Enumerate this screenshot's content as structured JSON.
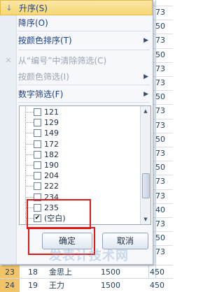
{
  "sheet": {
    "right_values": [
      "73",
      "50",
      "73",
      "50",
      "73",
      "73",
      "50",
      "73",
      "73",
      "50",
      "73",
      "50",
      "73",
      "73",
      "40",
      "73",
      "50",
      "73"
    ],
    "bottom_rows": [
      {
        "row": "23",
        "col_b": "18",
        "name": "金思上",
        "amount": "1500",
        "last": "450"
      },
      {
        "row": "24",
        "col_b": "19",
        "name": "王力",
        "amount": "1500",
        "last": "450"
      }
    ]
  },
  "menu": {
    "items": [
      {
        "label": "升序(S)",
        "icon": "sort-asc-icon",
        "glyph": "↓",
        "disabled": false,
        "hover": true,
        "arrow": false
      },
      {
        "label": "降序(O)",
        "icon": "sort-desc-icon",
        "glyph": "",
        "disabled": false,
        "hover": false,
        "arrow": false
      },
      {
        "label": "按颜色排序(T)",
        "icon": "",
        "glyph": "",
        "disabled": false,
        "hover": false,
        "arrow": true
      },
      {
        "label": "从“编号”中清除筛选(C)",
        "icon": "clear-filter-icon",
        "glyph": "✕",
        "disabled": true,
        "hover": false,
        "arrow": false
      },
      {
        "label": "按颜色筛选(I)",
        "icon": "",
        "glyph": "",
        "disabled": true,
        "hover": false,
        "arrow": true
      },
      {
        "label": "数字筛选(F)",
        "icon": "",
        "glyph": "",
        "disabled": false,
        "hover": false,
        "arrow": true
      }
    ],
    "list": [
      {
        "text": "121",
        "checked": false
      },
      {
        "text": "129",
        "checked": false
      },
      {
        "text": "149",
        "checked": false
      },
      {
        "text": "172",
        "checked": false
      },
      {
        "text": "182",
        "checked": false
      },
      {
        "text": "190",
        "checked": false
      },
      {
        "text": "204",
        "checked": false
      },
      {
        "text": "222",
        "checked": false
      },
      {
        "text": "234",
        "checked": false
      },
      {
        "text": "235",
        "checked": false
      },
      {
        "text": "(空白)",
        "checked": true
      }
    ],
    "ok_label": "确定",
    "cancel_label": "取消"
  },
  "watermark": "发表计技术网",
  "colors": {
    "highlight_box": "#e01818",
    "hover_fill": "#f7d774",
    "menu_text": "#1c3f8a"
  }
}
